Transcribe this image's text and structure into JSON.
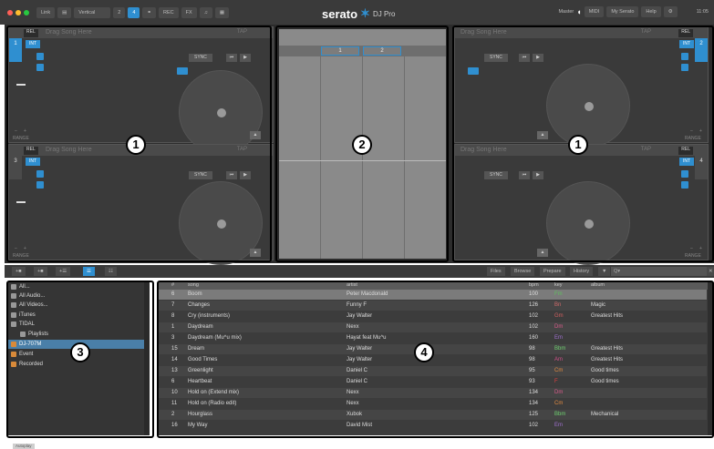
{
  "topbar": {
    "link": "Link",
    "layout": "Vertical",
    "deck_2": "2",
    "deck_4": "4",
    "rec": "REC",
    "fx": "FX",
    "app_name": "serato",
    "app_sub": "DJ Pro",
    "master": "Master",
    "midi": "MIDI",
    "my_serato": "My Serato",
    "help": "Help",
    "clock": "11:05"
  },
  "decks": {
    "drag_text": "Drag Song Here",
    "tap": "TAP",
    "rel": "REL",
    "int": "INT",
    "sync": "SYNC",
    "range": "RANGE",
    "minus": "–",
    "plus": "+",
    "n1": "1",
    "n2": "2",
    "n3": "3",
    "n4": "4"
  },
  "center": {
    "tab_1": "1",
    "tab_2": "2"
  },
  "library_bar": {
    "files": "Files",
    "browse": "Browse",
    "prepare": "Prepare",
    "history": "History",
    "search_placeholder": "Q▾"
  },
  "crates": [
    {
      "label": "All..."
    },
    {
      "label": "All Audio..."
    },
    {
      "label": "All Videos..."
    },
    {
      "label": "iTunes"
    },
    {
      "label": "TIDAL"
    },
    {
      "label": "Playlists"
    },
    {
      "label": "DJ-707M"
    },
    {
      "label": "Event"
    },
    {
      "label": "Recorded"
    }
  ],
  "tracks": {
    "headers": {
      "num": "#",
      "song": "song",
      "artist": "artist",
      "bpm": "bpm",
      "key": "key",
      "album": "album"
    },
    "rows": [
      {
        "num": "6",
        "song": "Boom",
        "artist": "Peter Macdonald",
        "bpm": "100",
        "key": "Fm",
        "album": ""
      },
      {
        "num": "7",
        "song": "Changes",
        "artist": "Funny F",
        "bpm": "126",
        "key": "Bn",
        "album": "Magic"
      },
      {
        "num": "8",
        "song": "Cry (instruments)",
        "artist": "Jay Walter",
        "bpm": "102",
        "key": "Gm",
        "album": "Greatest Hits"
      },
      {
        "num": "1",
        "song": "Daydream",
        "artist": "Nexx",
        "bpm": "102",
        "key": "Dm",
        "album": ""
      },
      {
        "num": "3",
        "song": "Daydream (Mu^u mix)",
        "artist": "Hayat feat Mu^u",
        "bpm": "160",
        "key": "Em",
        "album": ""
      },
      {
        "num": "15",
        "song": "Dream",
        "artist": "Jay Walter",
        "bpm": "98",
        "key": "Bbm",
        "album": "Greatest Hits"
      },
      {
        "num": "14",
        "song": "Good Times",
        "artist": "Jay Walter",
        "bpm": "98",
        "key": "Am",
        "album": "Greatest Hits"
      },
      {
        "num": "13",
        "song": "Greenlight",
        "artist": "Daniel C",
        "bpm": "95",
        "key": "Cm",
        "album": "Good times"
      },
      {
        "num": "6",
        "song": "Heartbeat",
        "artist": "Daniel C",
        "bpm": "93",
        "key": "F",
        "album": "Good times"
      },
      {
        "num": "10",
        "song": "Hold on (Extend mix)",
        "artist": "Nexx",
        "bpm": "134",
        "key": "Dm",
        "album": ""
      },
      {
        "num": "11",
        "song": "Hold on (Radio edit)",
        "artist": "Nexx",
        "bpm": "134",
        "key": "Cm",
        "album": ""
      },
      {
        "num": "2",
        "song": "Hourglass",
        "artist": "Xubok",
        "bpm": "125",
        "key": "Bbm",
        "album": "Mechanical"
      },
      {
        "num": "16",
        "song": "My Way",
        "artist": "David Mist",
        "bpm": "102",
        "key": "Em",
        "album": ""
      }
    ]
  },
  "annotations": {
    "a1": "1",
    "a2": "2",
    "a3": "3",
    "a4": "4"
  },
  "autoplay": "Autoplay",
  "colors": {
    "accent": "#2f8fd0",
    "key_colors": {
      "Fm": "#5fbf5f",
      "Bn": "#d06a6a",
      "Gm": "#d06060",
      "Dm": "#d85a8a",
      "Em": "#a070d0",
      "Bbm": "#6fd070",
      "Am": "#d0508a",
      "Cm": "#e08a40",
      "F": "#e04040"
    }
  }
}
